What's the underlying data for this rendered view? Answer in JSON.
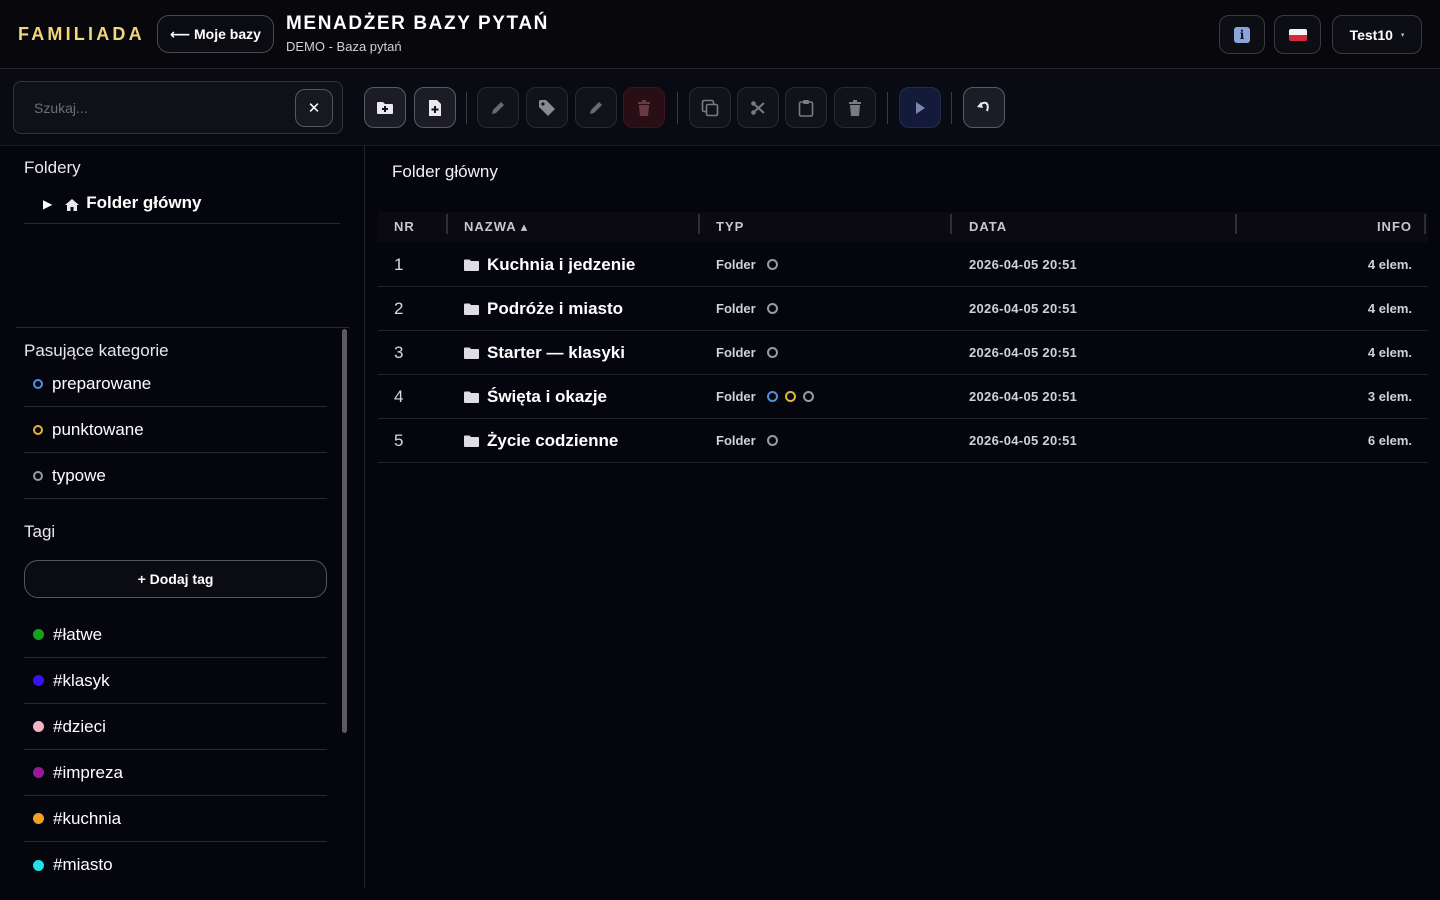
{
  "header": {
    "brand": "FAMILIADA",
    "back_label": "⟵ Moje bazy",
    "title": "MENADŻER BAZY PYTAŃ",
    "subtitle": "DEMO - Baza pytań",
    "user_label": "Test10",
    "user_caret": "▾"
  },
  "toolbar": {
    "search_placeholder": "Szukaj...",
    "clear_glyph": "✕",
    "buttons": [
      "new-folder",
      "new-question",
      "rename",
      "tag",
      "edit",
      "delete",
      "copy",
      "cut",
      "paste",
      "delete-all",
      "play",
      "undo"
    ]
  },
  "sidebar": {
    "folders_title": "Foldery",
    "root_folder": "Folder główny",
    "categories_title": "Pasujące kategorie",
    "categories": [
      {
        "label": "preparowane",
        "color": "#4f8fe0"
      },
      {
        "label": "punktowane",
        "color": "#e4b33a"
      },
      {
        "label": "typowe",
        "color": "#9a9aa4"
      }
    ],
    "tags_title": "Tagi",
    "add_tag_label": "+ Dodaj tag",
    "tags": [
      {
        "label": "#łatwe",
        "color": "#15a11e"
      },
      {
        "label": "#klasyk",
        "color": "#3b10f5"
      },
      {
        "label": "#dzieci",
        "color": "#f4b3c2"
      },
      {
        "label": "#impreza",
        "color": "#9c189a"
      },
      {
        "label": "#kuchnia",
        "color": "#f2a11e"
      },
      {
        "label": "#miasto",
        "color": "#20e0e8"
      }
    ]
  },
  "main": {
    "breadcrumb": "Folder główny",
    "columns": {
      "nr": "NR",
      "name": "NAZWA ▴",
      "type": "TYP",
      "date": "DATA",
      "info": "INFO"
    },
    "rows": [
      {
        "nr": "1",
        "name": "Kuchnia i jedzenie",
        "type": "Folder",
        "rings": [
          "#9a9aa4"
        ],
        "date": "2026-04-05 20:51",
        "info": "4 elem."
      },
      {
        "nr": "2",
        "name": "Podróże i miasto",
        "type": "Folder",
        "rings": [
          "#9a9aa4"
        ],
        "date": "2026-04-05 20:51",
        "info": "4 elem."
      },
      {
        "nr": "3",
        "name": "Starter — klasyki",
        "type": "Folder",
        "rings": [
          "#9a9aa4"
        ],
        "date": "2026-04-05 20:51",
        "info": "4 elem."
      },
      {
        "nr": "4",
        "name": "Święta i okazje",
        "type": "Folder",
        "rings": [
          "#4f8fe0",
          "#e4b33a",
          "#9a9aa4"
        ],
        "date": "2026-04-05 20:51",
        "info": "3 elem."
      },
      {
        "nr": "5",
        "name": "Życie codzienne",
        "type": "Folder",
        "rings": [
          "#9a9aa4"
        ],
        "date": "2026-04-05 20:51",
        "info": "6 elem."
      }
    ]
  }
}
